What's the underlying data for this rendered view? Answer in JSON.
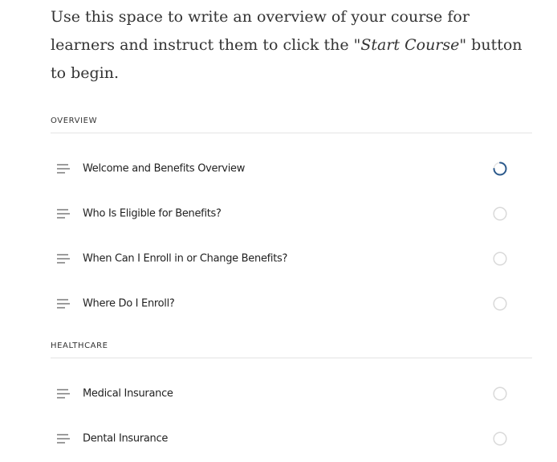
{
  "intro": {
    "text_before": "Use this space to write an overview of your course for learners and instruct them to click the \"",
    "emphasis": "Start Course",
    "text_after": "\" button to begin."
  },
  "sections": [
    {
      "heading": "OVERVIEW",
      "lessons": [
        {
          "title": "Welcome and Benefits Overview",
          "status": "in-progress",
          "icon": "lines-icon"
        },
        {
          "title": "Who Is Eligible for Benefits?",
          "status": "not-started",
          "icon": "lines-icon"
        },
        {
          "title": "When Can I Enroll in or Change Benefits?",
          "status": "not-started",
          "icon": "lines-icon"
        },
        {
          "title": "Where Do I Enroll?",
          "status": "not-started",
          "icon": "lines-icon"
        }
      ]
    },
    {
      "heading": "HEALTHCARE",
      "lessons": [
        {
          "title": "Medical Insurance",
          "status": "not-started",
          "icon": "lines-icon"
        },
        {
          "title": "Dental Insurance",
          "status": "not-started",
          "icon": "lines-icon"
        }
      ]
    }
  ],
  "colors": {
    "text": "#333333",
    "divider": "#e4e4e4",
    "progress_accent": "#2c5a8c",
    "status_ring": "#d9d9d9"
  }
}
